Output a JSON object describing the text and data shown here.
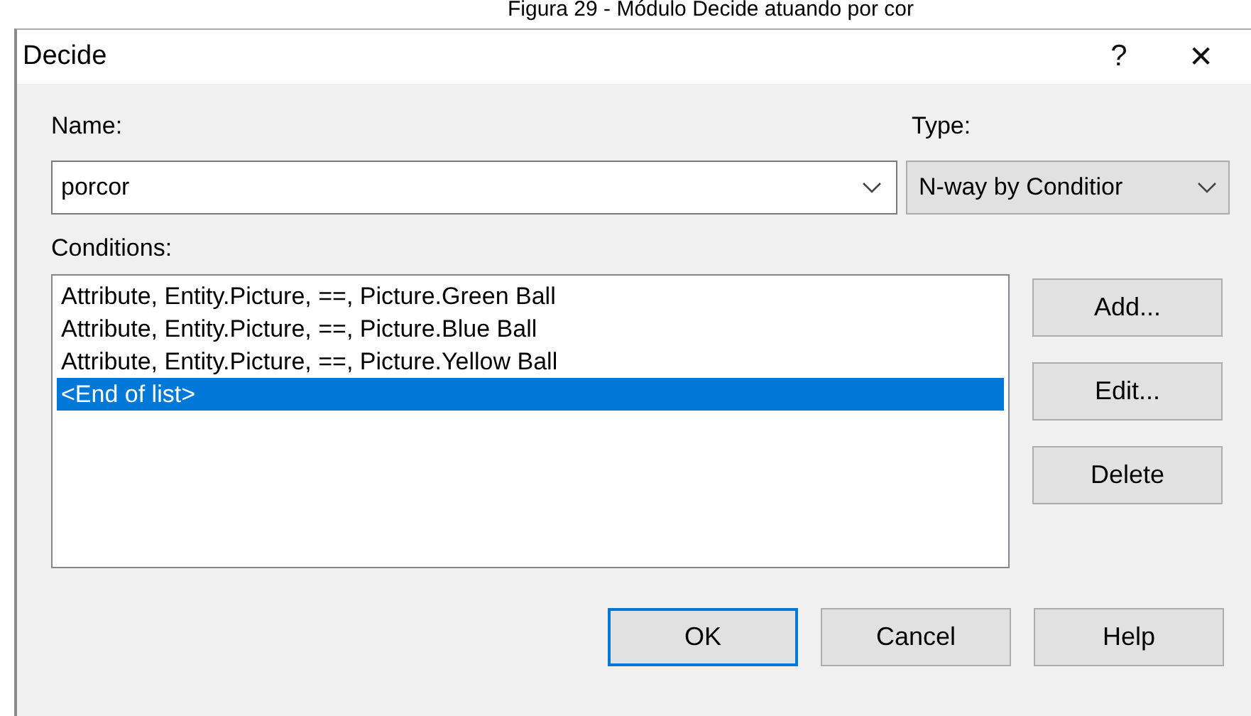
{
  "caption": "Figura 29 - Módulo Decide atuando por cor",
  "window": {
    "title": "Decide",
    "help": "?",
    "close": "✕"
  },
  "name": {
    "label": "Name:",
    "value": "porcor"
  },
  "type": {
    "label": "Type:",
    "value": "N-way by Conditior"
  },
  "conditions": {
    "label": "Conditions:",
    "items": [
      {
        "text": "Attribute, Entity.Picture, ==, Picture.Green Ball",
        "selected": false
      },
      {
        "text": "Attribute, Entity.Picture, ==, Picture.Blue Ball",
        "selected": false
      },
      {
        "text": "Attribute, Entity.Picture, ==, Picture.Yellow Ball",
        "selected": false
      },
      {
        "text": "<End of list>",
        "selected": true
      }
    ]
  },
  "side_buttons": [
    "Add...",
    "Edit...",
    "Delete"
  ],
  "buttons": [
    {
      "label": "OK",
      "default": true
    },
    {
      "label": "Cancel",
      "default": false
    },
    {
      "label": "Help",
      "default": false
    }
  ]
}
